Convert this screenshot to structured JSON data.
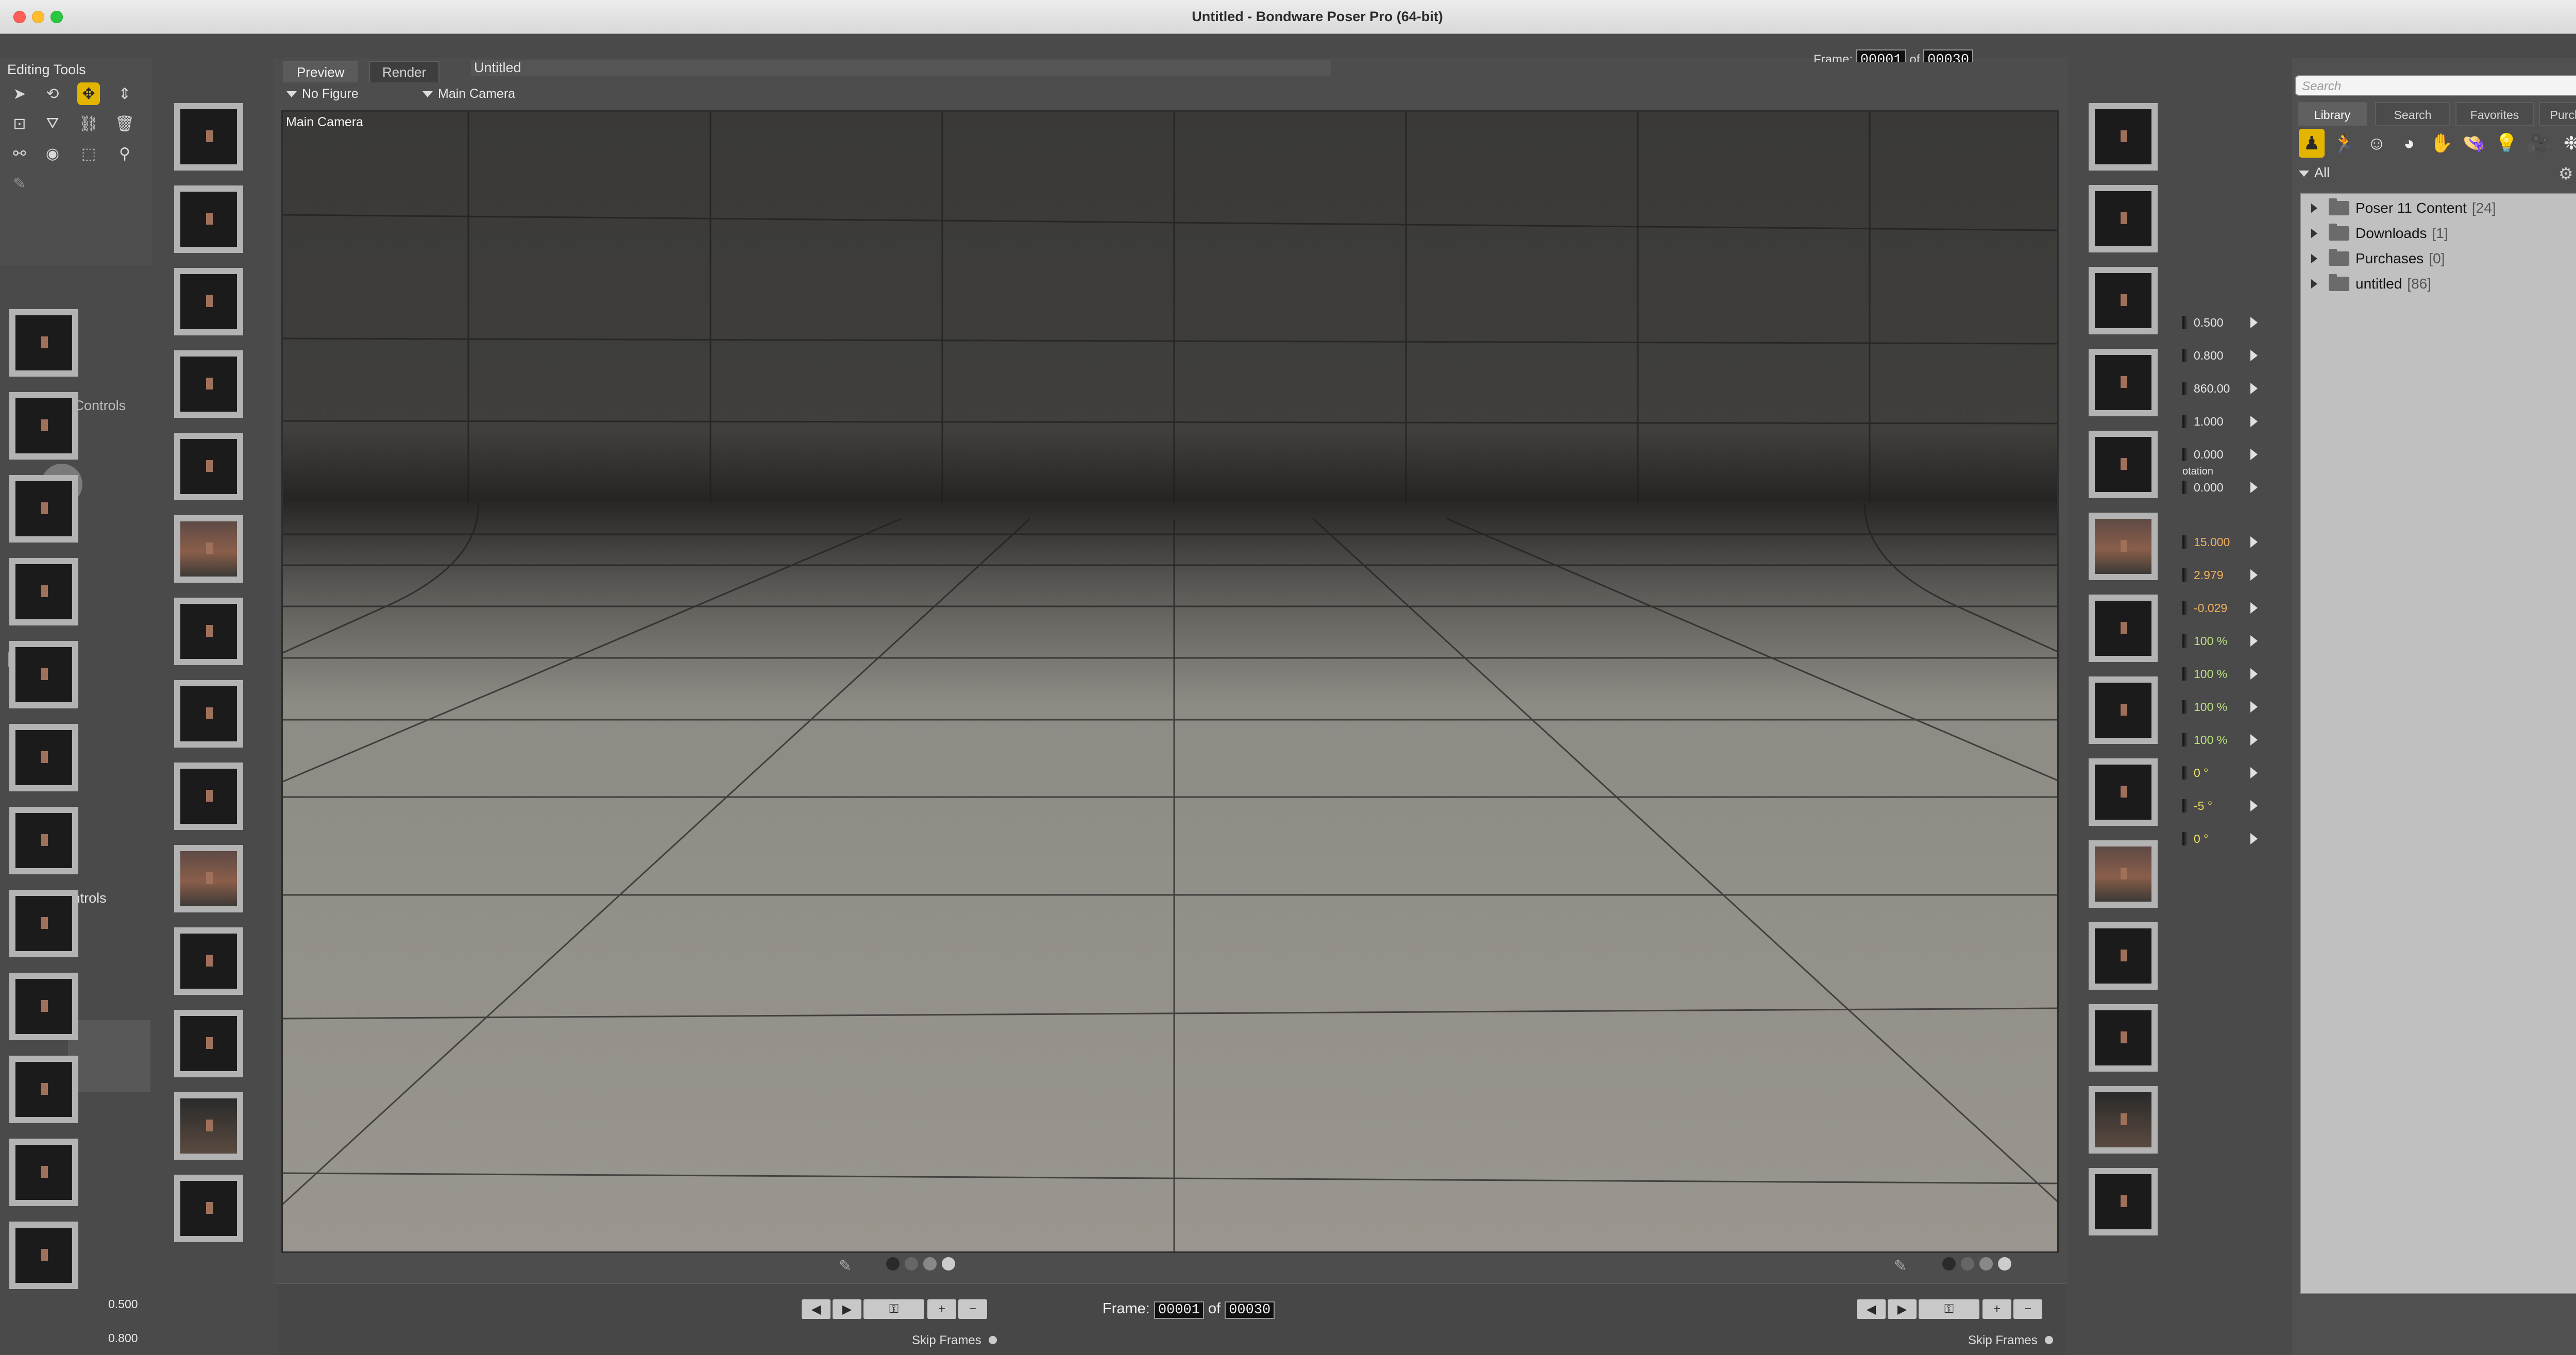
{
  "window": {
    "title": "Untitled - Bondware Poser Pro  (64-bit)"
  },
  "editing_tools": {
    "title": "Editing Tools",
    "tools": [
      {
        "name": "select",
        "icon": "arrow-select-icon"
      },
      {
        "name": "rotate",
        "icon": "rotate-icon"
      },
      {
        "name": "translate",
        "icon": "translate-move-icon",
        "active": true
      },
      {
        "name": "translate-in-out",
        "icon": "translate-in-out-icon"
      },
      {
        "name": "scale",
        "icon": "scale-icon"
      },
      {
        "name": "taper",
        "icon": "taper-icon"
      },
      {
        "name": "chain-break",
        "icon": "chain-break-icon"
      },
      {
        "name": "color",
        "icon": "color-icon"
      },
      {
        "name": "grouping",
        "icon": "grouping-icon"
      },
      {
        "name": "view-magnifier",
        "icon": "view-magnifier-icon"
      },
      {
        "name": "morphing",
        "icon": "morphing-icon"
      },
      {
        "name": "direct-manipulation",
        "icon": "direct-manipulation-icon"
      },
      {
        "name": "zoom",
        "icon": "magnifier-icon"
      }
    ]
  },
  "camera_controls": {
    "title": "Camera Controls"
  },
  "light_controls": {
    "title": "Light Controls"
  },
  "left_parameter_values": [
    "0.500",
    "0.800"
  ],
  "document": {
    "tabs": [
      {
        "label": "Preview",
        "active": true
      },
      {
        "label": "Render",
        "active": false
      },
      {
        "label": "Untitled",
        "active": false
      }
    ],
    "figure_menu": "No Figure",
    "camera_menu": "Main Camera",
    "viewport_label": "Main Camera"
  },
  "parameters": {
    "partial_label": "otation",
    "values": [
      {
        "value": "0.500",
        "color": "#e6e6e6"
      },
      {
        "value": "0.800",
        "color": "#e6e6e6"
      },
      {
        "value": "860.00",
        "color": "#e6e6e6"
      },
      {
        "value": "1.000",
        "color": "#e6e6e6"
      },
      {
        "value": "0.000",
        "color": "#e6e6e6"
      },
      {
        "value": "0.000",
        "color": "#e6e6e6"
      },
      {
        "value": "15.000",
        "color": "#f0b060"
      },
      {
        "value": "2.979",
        "color": "#f0b060"
      },
      {
        "value": "-0.029",
        "color": "#f0b060"
      },
      {
        "value": "100 %",
        "color": "#b8e080"
      },
      {
        "value": "100 %",
        "color": "#b8e080"
      },
      {
        "value": "100 %",
        "color": "#b8e080"
      },
      {
        "value": "100 %",
        "color": "#b8e080"
      },
      {
        "value": "0 °",
        "color": "#f0e060"
      },
      {
        "value": "-5 °",
        "color": "#f0e060"
      },
      {
        "value": "0 °",
        "color": "#f0e060"
      }
    ]
  },
  "library": {
    "search_placeholder": "Search",
    "tabs": [
      {
        "label": "Library",
        "active": true
      },
      {
        "label": "Search",
        "active": false
      },
      {
        "label": "Favorites",
        "active": false
      },
      {
        "label": "Purchases",
        "active": false
      }
    ],
    "categories": [
      {
        "icon": "figures-icon",
        "glyph": "♟",
        "active": true
      },
      {
        "icon": "poses-icon",
        "glyph": "🏃"
      },
      {
        "icon": "expressions-icon",
        "glyph": "☺"
      },
      {
        "icon": "hair-icon",
        "glyph": "◕"
      },
      {
        "icon": "hands-icon",
        "glyph": "✋"
      },
      {
        "icon": "props-icon",
        "glyph": "👒"
      },
      {
        "icon": "lights-icon",
        "glyph": "💡"
      },
      {
        "icon": "cameras-icon",
        "glyph": "🎥"
      },
      {
        "icon": "materials-icon",
        "glyph": "❉"
      },
      {
        "icon": "scenes-icon",
        "glyph": "◔"
      }
    ],
    "root_label": "All",
    "folders": [
      {
        "name": "Poser 11 Content",
        "count": "[24]"
      },
      {
        "name": "Downloads",
        "count": "[1]"
      },
      {
        "name": "Purchases",
        "count": "[0]"
      },
      {
        "name": "untitled",
        "count": "[86]"
      }
    ]
  },
  "timeline": {
    "frame_label": "Frame:",
    "current_frame": "00001",
    "of_label": "of",
    "total_frames": "00030",
    "skip_frames_label": "Skip Frames",
    "top_frame_label": "Frame:",
    "top_current_frame": "00001",
    "top_total_frames": "00030"
  }
}
